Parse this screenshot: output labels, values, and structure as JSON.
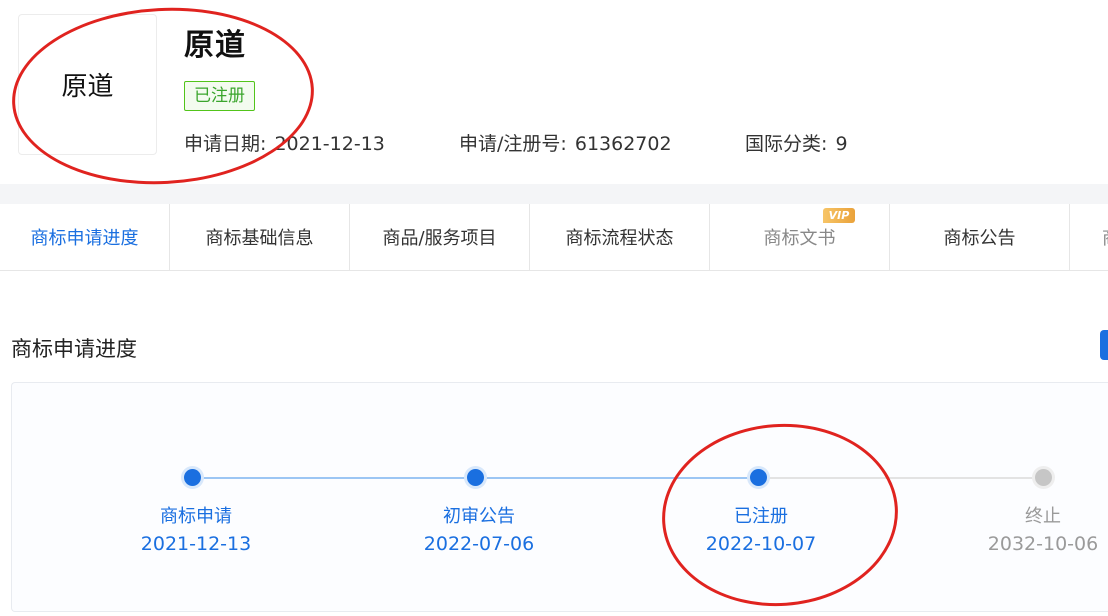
{
  "trademark": {
    "logo_text": "原道",
    "name": "原道",
    "status": "已注册",
    "apply_date_label": "申请日期:",
    "apply_date": "2021-12-13",
    "reg_no_label": "申请/注册号:",
    "reg_no": "61362702",
    "class_label": "国际分类:",
    "class_value": "9"
  },
  "tabs": [
    {
      "label": "商标申请进度",
      "active": true
    },
    {
      "label": "商标基础信息"
    },
    {
      "label": "商品/服务项目"
    },
    {
      "label": "商标流程状态"
    },
    {
      "label": "商标文书",
      "badge": "VIP"
    },
    {
      "label": "商标公告"
    },
    {
      "label": "商"
    }
  ],
  "progress": {
    "title": "商标申请进度",
    "steps": [
      {
        "label": "商标申请",
        "date": "2021-12-13",
        "done": true
      },
      {
        "label": "初审公告",
        "date": "2022-07-06",
        "done": true
      },
      {
        "label": "已注册",
        "date": "2022-10-07",
        "done": true
      },
      {
        "label": "终止",
        "date": "2032-10-06",
        "done": false
      }
    ]
  },
  "colors": {
    "accent": "#1a6fe0",
    "status_green": "#52c41a",
    "annotation_red": "#e0231f",
    "pending_gray": "#c6c6c6"
  }
}
